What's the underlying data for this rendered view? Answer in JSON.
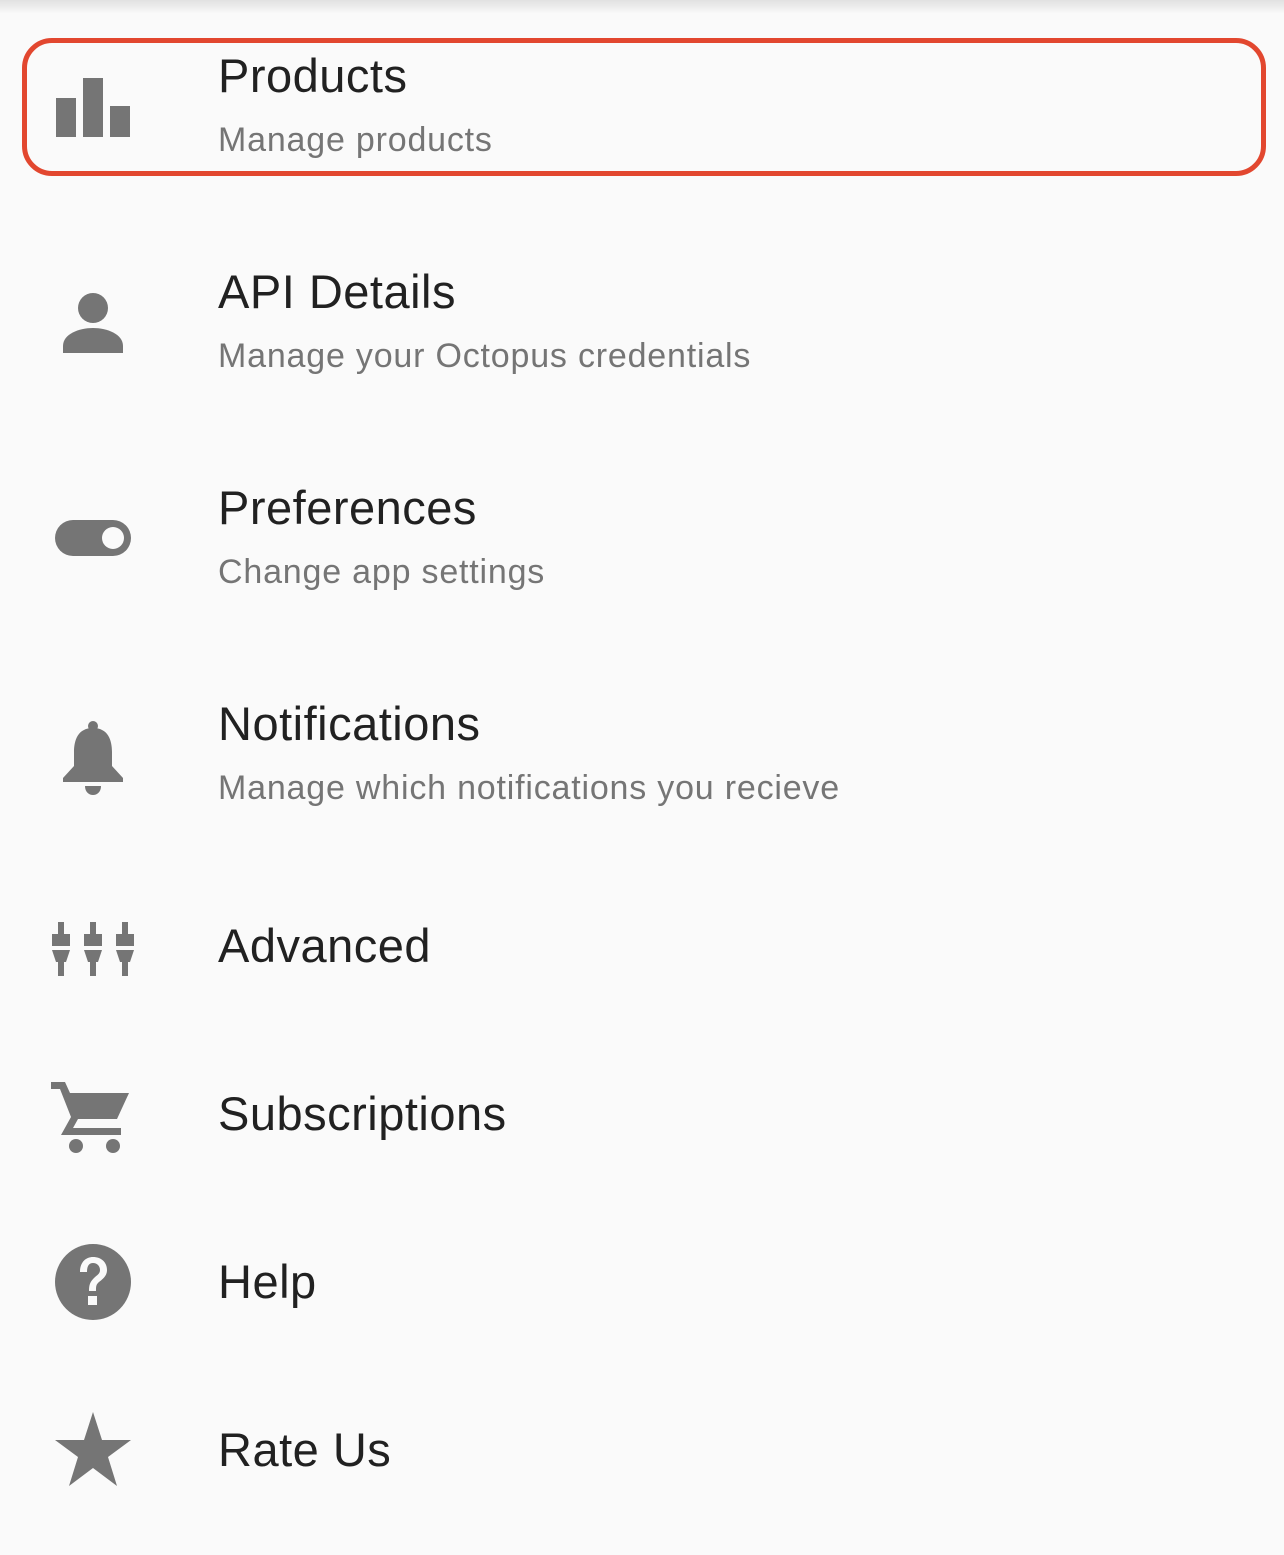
{
  "settings": {
    "items": [
      {
        "title": "Products",
        "subtitle": "Manage products",
        "icon": "bar-chart-icon"
      },
      {
        "title": "API Details",
        "subtitle": "Manage your Octopus credentials",
        "icon": "person-icon"
      },
      {
        "title": "Preferences",
        "subtitle": "Change app settings",
        "icon": "toggle-icon"
      },
      {
        "title": "Notifications",
        "subtitle": "Manage which notifications you recieve",
        "icon": "bell-icon"
      },
      {
        "title": "Advanced",
        "icon": "sliders-icon"
      },
      {
        "title": "Subscriptions",
        "icon": "cart-icon"
      },
      {
        "title": "Help",
        "icon": "help-icon"
      },
      {
        "title": "Rate Us",
        "icon": "star-icon"
      }
    ]
  },
  "colors": {
    "icon": "#757575",
    "title": "#212121",
    "subtitle": "#757575",
    "highlight": "#e2472f",
    "background": "#fafafa"
  }
}
